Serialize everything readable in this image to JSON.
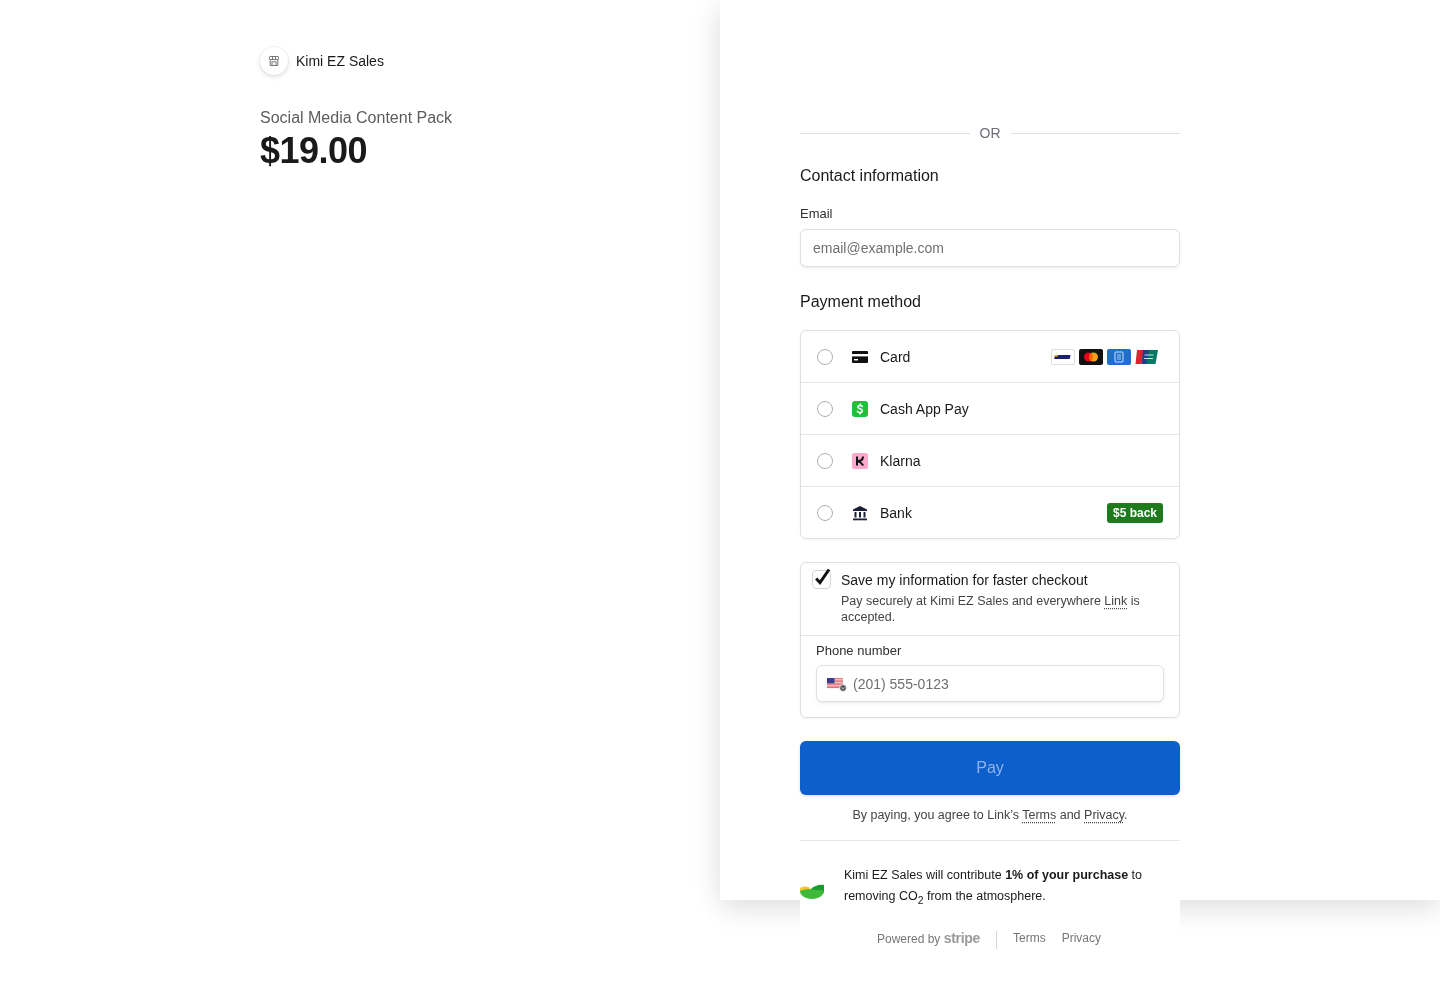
{
  "merchant": {
    "name": "Kimi EZ Sales"
  },
  "product": {
    "name": "Social Media Content Pack",
    "price": "$19.00"
  },
  "divider_label": "OR",
  "contact": {
    "heading": "Contact information",
    "email": {
      "label": "Email",
      "placeholder": "email@example.com"
    }
  },
  "payment": {
    "heading": "Payment method",
    "methods": [
      {
        "kind": "card",
        "label": "Card",
        "selected": false
      },
      {
        "kind": "cashapp",
        "label": "Cash App Pay",
        "selected": false
      },
      {
        "kind": "klarna",
        "label": "Klarna",
        "selected": false
      },
      {
        "kind": "bank",
        "label": "Bank",
        "selected": false,
        "badge": "$5 back"
      }
    ]
  },
  "save_info": {
    "checked": true,
    "title": "Save my information for faster checkout",
    "description": [
      {
        "kind": "text",
        "text": "Pay securely at Kimi EZ Sales and everywhere "
      },
      {
        "kind": "link",
        "text": "Link"
      },
      {
        "kind": "text",
        "text": " is accepted."
      }
    ],
    "phone": {
      "label": "Phone number",
      "placeholder": "(201) 555-0123"
    }
  },
  "pay_button": {
    "label": "Pay",
    "disabled": true
  },
  "legal": [
    {
      "kind": "text",
      "text": "By paying, you agree to Link’s "
    },
    {
      "kind": "link",
      "text": "Terms"
    },
    {
      "kind": "text",
      "text": " and "
    },
    {
      "kind": "link",
      "text": "Privacy"
    },
    {
      "kind": "text",
      "text": "."
    }
  ],
  "climate": {
    "text": "Kimi EZ Sales will contribute **1% of your purchase** to removing CO$_{2}$ from the atmosphere."
  },
  "footer": {
    "powered_by": "Powered by",
    "brand": "stripe",
    "links": [
      "Terms",
      "Privacy"
    ]
  }
}
